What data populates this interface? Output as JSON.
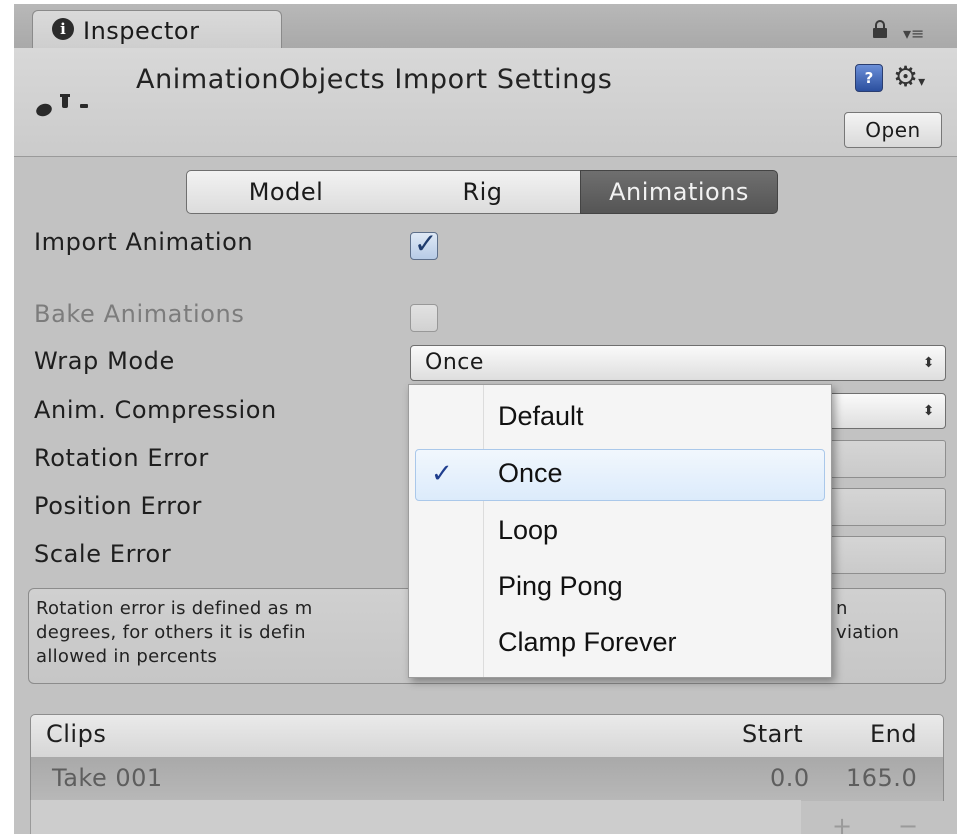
{
  "tab": {
    "label": "Inspector",
    "info_glyph": "i"
  },
  "header": {
    "title": "AnimationObjects Import Settings",
    "open_label": "Open",
    "help_glyph": "?"
  },
  "segments": [
    "Model",
    "Rig",
    "Animations"
  ],
  "active_segment": "Animations",
  "fields": {
    "import_animation": {
      "label": "Import Animation",
      "checked": true
    },
    "bake_animations": {
      "label": "Bake Animations",
      "checked": false,
      "disabled": true
    },
    "wrap_mode": {
      "label": "Wrap Mode",
      "value": "Once"
    },
    "anim_compression": {
      "label": "Anim. Compression"
    },
    "rotation_error": {
      "label": "Rotation Error"
    },
    "position_error": {
      "label": "Position Error"
    },
    "scale_error": {
      "label": "Scale Error"
    }
  },
  "help_text_lines": [
    "Rotation error is defined as m",
    "degrees, for others it is defin",
    "allowed in percents"
  ],
  "help_text_right": [
    "n",
    "viation"
  ],
  "wrap_menu": {
    "options": [
      "Default",
      "Once",
      "Loop",
      "Ping Pong",
      "Clamp Forever"
    ],
    "selected": "Once"
  },
  "clips": {
    "headers": {
      "name": "Clips",
      "start": "Start",
      "end": "End"
    },
    "rows": [
      {
        "name": "Take 001",
        "start": "0.0",
        "end": "165.0"
      }
    ]
  },
  "icons": {
    "tab": "info-icon",
    "lock": "lock-icon",
    "menu": "menu-icon",
    "help": "help-book-icon",
    "gear": "gear-icon",
    "check": "checkmark-icon",
    "select_arrows": "updown-arrows-icon"
  },
  "colors": {
    "panel": "#c2c2c2",
    "active_segment": "#5f5f5f",
    "menu_highlight": "#dcebfb",
    "check": "#1f3e8e"
  }
}
